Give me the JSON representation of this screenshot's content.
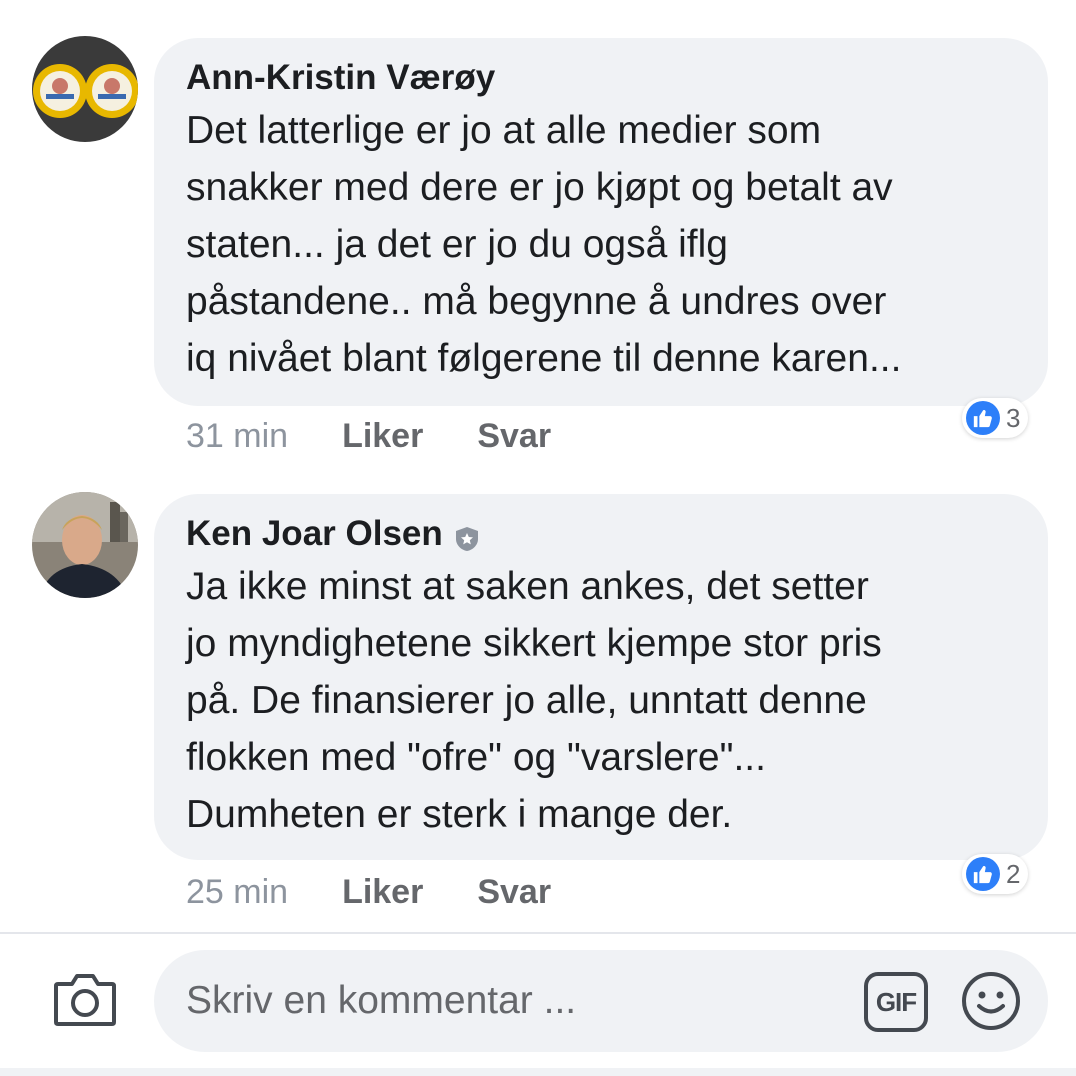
{
  "comments": [
    {
      "author": "Ann-Kristin Værøy",
      "text": "Det latterlige er jo at alle medier som\nsnakker med dere er jo kjøpt og betalt av\nstaten... ja det er jo du også iflg\npåstandene.. må begynne å undres over\niq nivået blant følgerene til denne karen...",
      "time": "31 min",
      "like_label": "Liker",
      "reply_label": "Svar",
      "reaction_count": "3",
      "avatar_icon": "cheese-lids-avatar-icon"
    },
    {
      "author": "Ken Joar Olsen",
      "author_badge_icon": "shield-badge-icon",
      "text": "Ja ikke minst at saken ankes, det setter\njo myndighetene sikkert kjempe stor pris\npå. De finansierer jo alle, unntatt denne\nflokken med \"ofre\" og \"varslere\"...\nDumheten er sterk i mange der.",
      "time": "25 min",
      "like_label": "Liker",
      "reply_label": "Svar",
      "reaction_count": "2",
      "avatar_icon": "man-portrait-avatar-icon"
    }
  ],
  "composer": {
    "placeholder": "Skriv en kommentar ...",
    "gif_label": "GIF",
    "camera_icon": "camera-icon",
    "emoji_icon": "smiley-icon"
  },
  "colors": {
    "bubble": "#f0f2f5",
    "like_blue": "#2d7ff9",
    "text": "#1c1e21",
    "muted": "#65676b"
  }
}
